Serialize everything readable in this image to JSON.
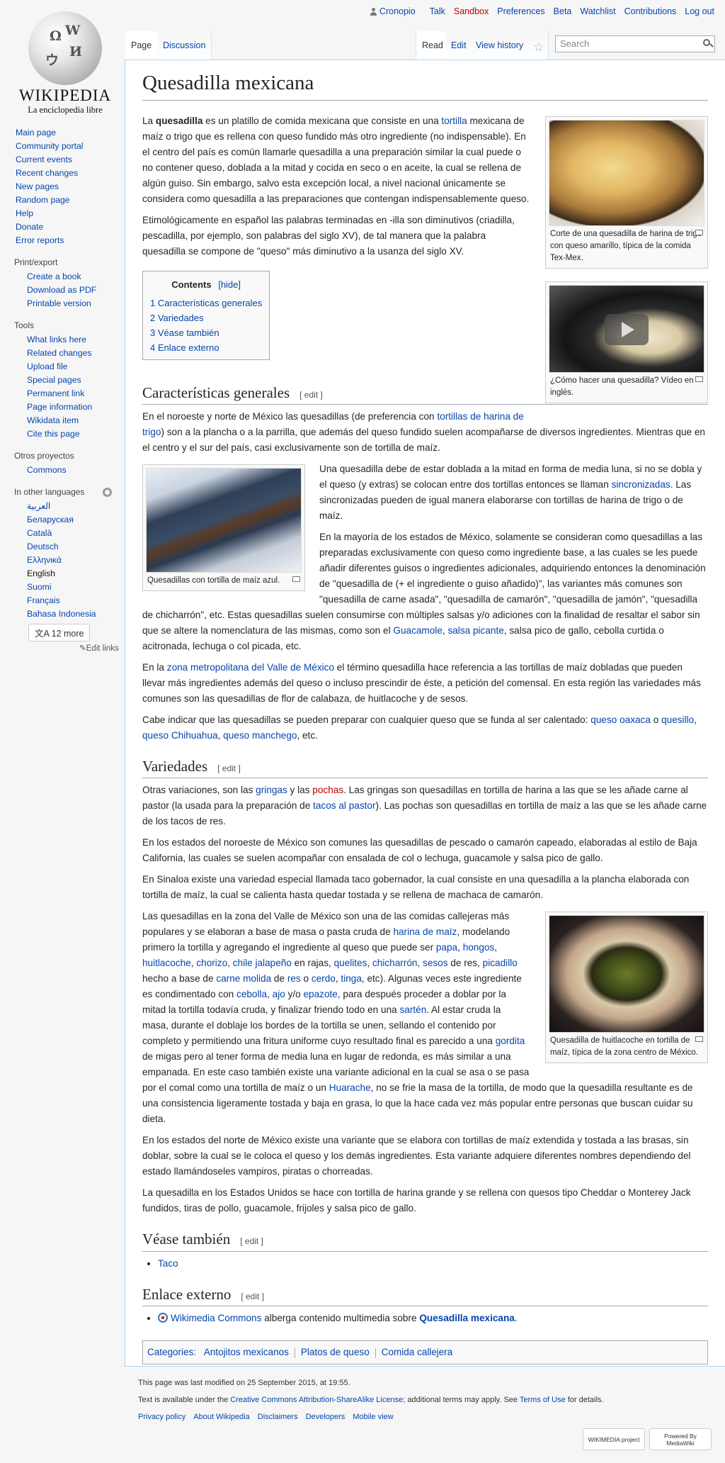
{
  "personal": {
    "user": "Cronopio",
    "links": [
      "Talk",
      "Sandbox",
      "Preferences",
      "Beta",
      "Watchlist",
      "Contributions",
      "Log out"
    ]
  },
  "logo": {
    "wordmark": "Wikipedia",
    "tagline": "La enciclopedia libre",
    "glyphs": [
      "Ω",
      "W",
      "И",
      "ウ"
    ]
  },
  "navigation": {
    "main": [
      "Main page",
      "Community portal",
      "Current events",
      "Recent changes",
      "New pages",
      "Random page",
      "Help",
      "Donate",
      "Error reports"
    ],
    "print_heading": "Print/export",
    "print": [
      "Create a book",
      "Download as PDF",
      "Printable version"
    ],
    "tools_heading": "Tools",
    "tools": [
      "What links here",
      "Related changes",
      "Upload file",
      "Special pages",
      "Permanent link",
      "Page information",
      "Wikidata item",
      "Cite this page"
    ],
    "other_heading": "Otros proyectos",
    "other": [
      "Commons"
    ],
    "lang_heading": "In other languages",
    "languages": [
      "العربية",
      "Беларуская",
      "Català",
      "Deutsch",
      "Ελληνικά",
      "English",
      "Suomi",
      "Français",
      "Bahasa Indonesia"
    ],
    "more_languages": "12 more",
    "edit_links": "Edit links"
  },
  "tabs": {
    "left": [
      "Page",
      "Discussion"
    ],
    "right": [
      "Read",
      "Edit",
      "View history"
    ],
    "search_placeholder": "Search"
  },
  "article": {
    "title": "Quesadilla mexicana",
    "intro_p1": {
      "a": "La ",
      "bold": "quesadilla",
      "b": " es un platillo de comida mexicana que consiste en una ",
      "link": "tortilla",
      "c": " mexicana de maíz o trigo que es rellena con queso fundido más otro ingrediente (no indispensable). En el centro del país es común llamarle quesadilla a una preparación similar la cual puede o no contener queso, doblada a la mitad y cocida en seco o en aceite, la cual se rellena de algún guiso. Sin embargo, salvo esta excepción local, a nivel nacional únicamente se considera como quesadilla a las preparaciones que contengan indispensablemente queso."
    },
    "intro_p2": "Etimológicamente en español las palabras terminadas en -illa son diminutivos (criadilla, pescadilla, por ejemplo, son palabras del siglo XV), de tal manera que la palabra quesadilla se compone de \"queso\" más diminutivo a la usanza del siglo XV.",
    "figure1_caption": "Corte de una quesadilla de harina de trigo con queso amarillo, típica de la comida Tex-Mex.",
    "figure2_caption": "¿Cómo hacer una quesadilla? Vídeo en inglés.",
    "toc": {
      "title": "Contents",
      "hide": "[hide]",
      "items": [
        "1 Características generales",
        "2 Variedades",
        "3 Véase también",
        "4 Enlace externo"
      ]
    },
    "edit_label": "[ edit ]",
    "s1": {
      "heading": "Características generales",
      "p1_a": "En el noroeste y norte de México las quesadillas (de preferencia con ",
      "p1_link": "tortillas de harina de trigo",
      "p1_b": ") son a la plancha o a la parrilla, que además del queso fundido suelen acompañarse de diversos ingredientes. Mientras que en el centro y el sur del país, casi exclusivamente son de tortilla de maíz.",
      "figure_caption": "Quesadillas con tortilla de maíz azul.",
      "p2_a": "Una quesadilla debe de estar doblada a la mitad en forma de media luna, si no se dobla y el queso (y extras) se colocan entre dos tortillas entonces se llaman ",
      "p2_link": "sincronizadas",
      "p2_b": ". Las sincronizadas pueden de igual manera elaborarse con tortillas de harina de trigo o de maíz.",
      "p3_a": "En la mayoría de los estados de México, solamente se consideran como quesadillas a las preparadas exclusivamente con queso como ingrediente base, a las cuales se les puede añadir diferentes guisos o ingredientes adicionales, adquiriendo entonces la denominación de \"quesadilla de (+ el ingrediente o guiso añadido)\", las variantes más comunes son \"quesadilla de carne asada\", \"quesadilla de camarón\", \"quesadilla de jamón\", \"quesadilla de chicharrón\", etc. Estas quesadillas suelen consumirse con múltiples salsas y/o adiciones con la finalidad de resaltar el sabor sin que se altere la nomenclatura de las mismas, como son el ",
      "p3_link1": "Guacamole",
      "p3_sep": ", ",
      "p3_link2": "salsa picante",
      "p3_b": ", salsa pico de gallo, cebolla curtida o acitronada, lechuga o col picada, etc.",
      "p4_a": "En la ",
      "p4_link": "zona metropolitana del Valle de México",
      "p4_b": " el término quesadilla hace referencia a las tortillas de maíz dobladas que pueden llevar más ingredientes además del queso o incluso prescindir de éste, a petición del comensal. En esta región las variedades más comunes son las quesadillas de flor de calabaza, de huitlacoche y de sesos.",
      "p5_a": "Cabe indicar que las quesadillas se pueden preparar con cualquier queso que se funda al ser calentado: ",
      "p5_link1": "queso oaxaca",
      "p5_o": " o ",
      "p5_link2": "quesillo",
      "p5_c1": ", ",
      "p5_link3": "queso Chihuahua",
      "p5_c2": ", ",
      "p5_link4": "queso manchego",
      "p5_b": ", etc."
    },
    "s2": {
      "heading": "Variedades",
      "p1_a": "Otras variaciones, son las ",
      "p1_link1": "gringas",
      "p1_y": " y las ",
      "p1_link2": "pochas",
      "p1_b": ". Las gringas son quesadillas en tortilla de harina a las que se les añade carne al pastor (la usada para la preparación de ",
      "p1_link3": "tacos al pastor",
      "p1_c": "). Las pochas son quesadillas en tortilla de maíz a las que se les añade carne de los tacos de res.",
      "p2": "En los estados del noroeste de México son comunes las quesadillas de pescado o camarón capeado, elaboradas al estilo de Baja California, las cuales se suelen acompañar con ensalada de col o lechuga, guacamole y salsa pico de gallo.",
      "p3": "En Sinaloa existe una variedad especial llamada taco gobernador, la cual consiste en una quesadilla a la plancha elaborada con tortilla de maíz, la cual se calienta hasta quedar tostada y se rellena de machaca de camarón.",
      "figure_caption": "Quesadilla de huitlacoche en tortilla de maíz, típica de la zona centro de México.",
      "p4": {
        "t1": "Las quesadillas en la zona del Valle de México son una de las comidas callejeras más populares y se elaboran a base de masa o pasta cruda de ",
        "l1": "harina de maíz",
        "t2": ", modelando primero la tortilla y agregando el ingrediente al queso que puede ser ",
        "l2": "papa",
        "l3": "hongos",
        "l4": "huitlacoche",
        "l5": "chorizo",
        "l6": "chile jalapeño",
        "t3": " en rajas, ",
        "l7": "quelites",
        "l8": "chicharrón",
        "l9": "sesos",
        "t4": " de res, ",
        "l10": "picadillo",
        "t5": " hecho a base de ",
        "l11": "carne molida",
        "t6": " de ",
        "l12": "res",
        "t7": " o ",
        "l13": "cerdo",
        "l14": "tinga",
        "t8": ", etc). Algunas veces este ingrediente es condimentado con ",
        "l15": "cebolla",
        "l16": "ajo",
        "t9": " y/o ",
        "l17": "epazote",
        "t10": ", para después proceder a doblar por la mitad la tortilla todavía cruda, y finalizar friendo todo en una ",
        "l18": "sartén",
        "t11": ". Al estar cruda la masa, durante el doblaje los bordes de la tortilla se unen, sellando el contenido por completo y permitiendo una fritura uniforme cuyo resultado final es parecido a una ",
        "l19": "gordita",
        "t12": " de migas pero al tener forma de media luna en lugar de redonda, es más similar a una empanada. En este caso también existe una variante adicional en la cual se asa o se pasa por el comal como una tortilla de maíz o un ",
        "l20": "Huarache",
        "t13": ", no se frie la masa de la tortilla, de modo que la quesadilla resultante es de una consistencia ligeramente tostada y baja en grasa, lo que la hace cada vez más popular entre personas que buscan cuidar su dieta.",
        "comma": ", "
      },
      "p5": "En los estados del norte de México existe una variante que se elabora con tortillas de maíz extendida y tostada a las brasas, sin doblar, sobre la cual se le coloca el queso y los demás ingredientes. Esta variante adquiere diferentes nombres dependiendo del estado llamándoseles vampiros, piratas o chorreadas.",
      "p6": "La quesadilla en los Estados Unidos se hace con tortilla de harina grande y se rellena con quesos tipo Cheddar o Monterey Jack fundidos, tiras de pollo, guacamole, frijoles y salsa pico de gallo."
    },
    "s3": {
      "heading": "Véase también",
      "items": [
        "Taco"
      ]
    },
    "s4": {
      "heading": "Enlace externo",
      "link": "Wikimedia Commons",
      "text": " alberga contenido multimedia sobre ",
      "bold_link": "Quesadilla mexicana",
      "end": "."
    },
    "categories": {
      "label": "Categories:",
      "items": [
        "Antojitos mexicanos",
        "Platos de queso",
        "Comida callejera"
      ]
    }
  },
  "footer": {
    "modified": "This page was last modified on 25 September 2015, at 19:55.",
    "license_a": "Text is available under the ",
    "license_link": "Creative Commons Attribution-ShareAlike License",
    "license_b": "; additional terms may apply. See ",
    "terms_link": "Terms of Use",
    "license_c": " for details.",
    "links": [
      "Privacy policy",
      "About Wikipedia",
      "Disclaimers",
      "Developers",
      "Mobile view"
    ],
    "badge1": "WIKIMEDIA project",
    "badge2": "Powered By MediaWiki"
  }
}
